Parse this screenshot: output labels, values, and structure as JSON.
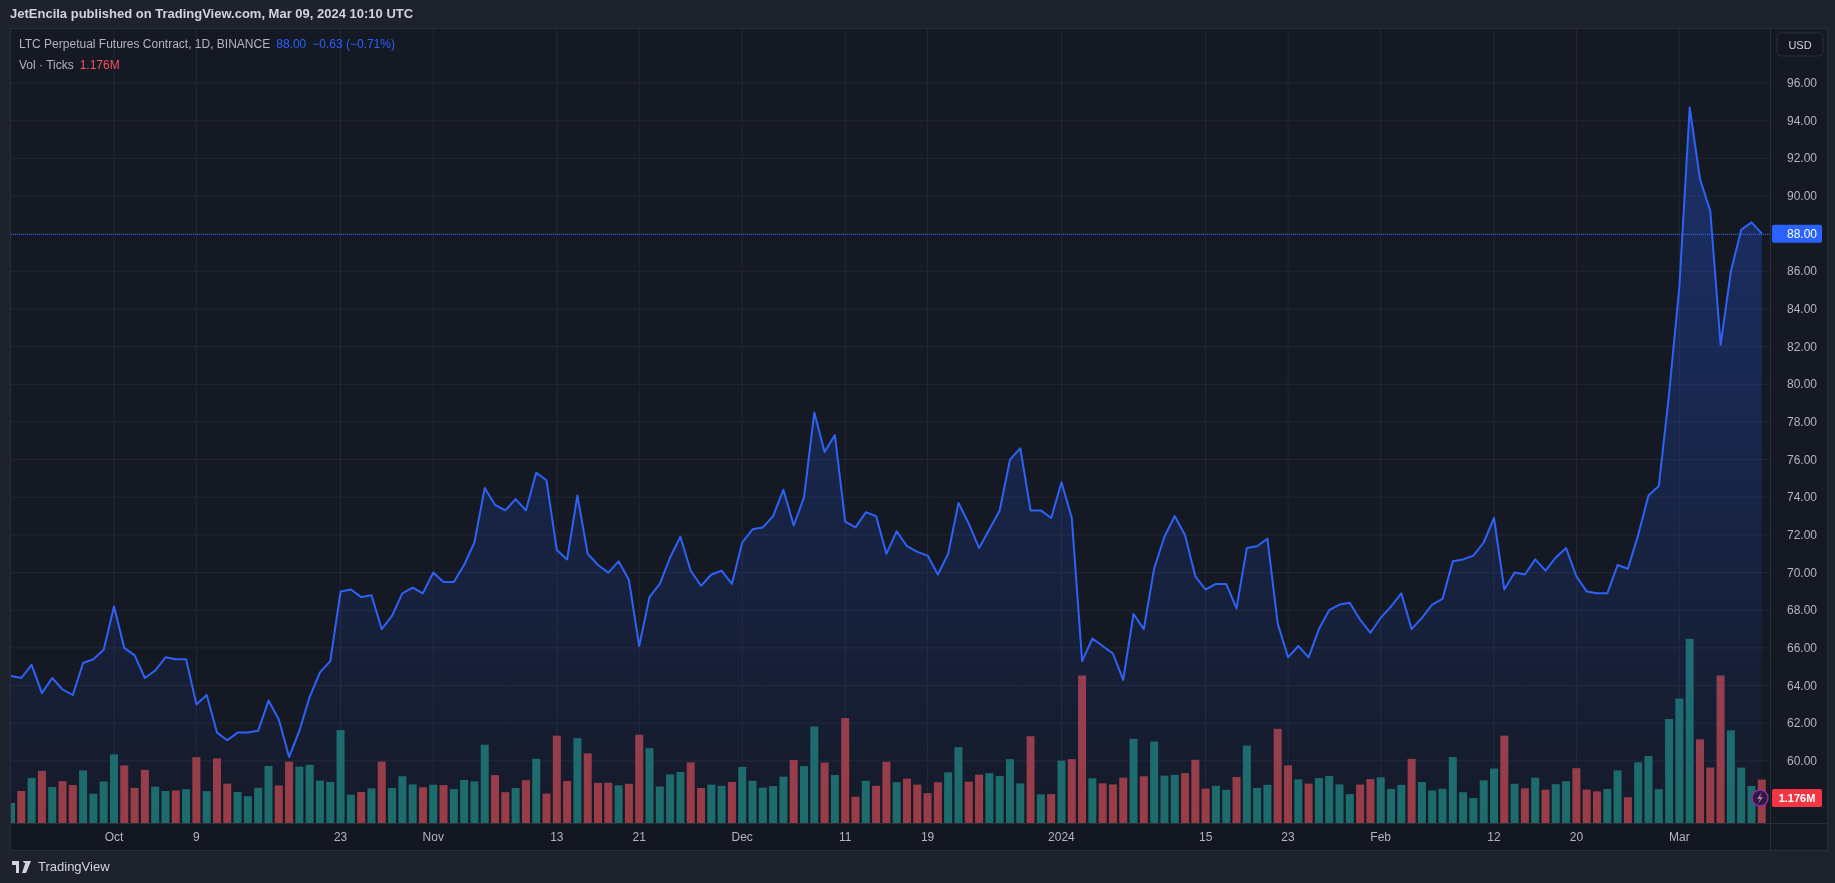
{
  "header": {
    "text": "JetEncila published on TradingView.com, Mar 09, 2024 10:10 UTC"
  },
  "legend": {
    "symbol": "LTC Perpetual Futures Contract, 1D, BINANCE",
    "price": "88.00",
    "change": "−0.63 (−0.71%)",
    "volume_label": "Vol · Ticks",
    "volume_value": "1.176M"
  },
  "price_axis": {
    "currency": "USD",
    "last_price_label": "88.00",
    "volume_badge": "1.176M"
  },
  "chart": {
    "chart_data": {
      "type": "area",
      "grid": true,
      "ylim": [
        56.7,
        98.87
      ],
      "categories": [
        null,
        null,
        null,
        null,
        null,
        null,
        null,
        null,
        null,
        null,
        "Oct",
        null,
        null,
        null,
        null,
        null,
        null,
        null,
        "9",
        null,
        null,
        null,
        null,
        null,
        null,
        null,
        null,
        null,
        null,
        null,
        null,
        null,
        "23",
        null,
        null,
        null,
        null,
        null,
        null,
        null,
        null,
        "Nov",
        null,
        null,
        null,
        null,
        null,
        null,
        null,
        null,
        null,
        null,
        null,
        "13",
        null,
        null,
        null,
        null,
        null,
        null,
        null,
        "21",
        null,
        null,
        null,
        null,
        null,
        null,
        null,
        null,
        null,
        "Dec",
        null,
        null,
        null,
        null,
        null,
        null,
        null,
        null,
        null,
        "11",
        null,
        null,
        null,
        null,
        null,
        null,
        null,
        "19",
        null,
        null,
        null,
        null,
        null,
        null,
        null,
        null,
        null,
        null,
        null,
        null,
        "2024",
        null,
        null,
        null,
        null,
        null,
        null,
        null,
        null,
        null,
        null,
        null,
        null,
        null,
        "15",
        null,
        null,
        null,
        null,
        null,
        null,
        null,
        "23",
        null,
        null,
        null,
        null,
        null,
        null,
        null,
        null,
        "Feb",
        null,
        null,
        null,
        null,
        null,
        null,
        null,
        null,
        null,
        null,
        "12",
        null,
        null,
        null,
        null,
        null,
        null,
        null,
        "20",
        null,
        null,
        null,
        null,
        null,
        null,
        null,
        null,
        null,
        "Mar",
        null,
        null,
        null,
        null,
        null,
        null,
        null,
        null
      ],
      "values": [
        64.5,
        64.4,
        65.1,
        63.6,
        64.4,
        63.8,
        63.5,
        65.2,
        65.4,
        65.9,
        68.2,
        66.0,
        65.6,
        64.4,
        64.8,
        65.5,
        65.4,
        65.4,
        63.0,
        63.5,
        61.5,
        61.1,
        61.5,
        61.5,
        61.6,
        63.2,
        62.2,
        60.2,
        61.6,
        63.4,
        64.7,
        65.3,
        69.0,
        69.1,
        68.7,
        68.8,
        67.0,
        67.7,
        68.9,
        69.2,
        68.9,
        70.0,
        69.5,
        69.5,
        70.4,
        71.6,
        74.5,
        73.6,
        73.3,
        73.9,
        73.3,
        75.3,
        74.9,
        71.2,
        70.7,
        74.1,
        71.0,
        70.4,
        70.0,
        70.6,
        69.6,
        66.1,
        68.7,
        69.4,
        70.8,
        71.9,
        70.1,
        69.3,
        69.9,
        70.1,
        69.4,
        71.6,
        72.3,
        72.4,
        73.0,
        74.4,
        72.5,
        74.0,
        78.5,
        76.4,
        77.3,
        72.7,
        72.4,
        73.2,
        73.0,
        71.0,
        72.2,
        71.4,
        71.1,
        70.9,
        69.9,
        71.0,
        73.7,
        72.6,
        71.3,
        72.3,
        73.3,
        76.0,
        76.6,
        73.3,
        73.3,
        72.9,
        74.8,
        72.9,
        65.3,
        66.5,
        66.1,
        65.7,
        64.3,
        67.8,
        67.0,
        70.2,
        71.9,
        73.0,
        72.0,
        69.8,
        69.1,
        69.4,
        69.4,
        68.1,
        71.3,
        71.4,
        71.8,
        67.3,
        65.5,
        66.1,
        65.5,
        67.0,
        68.0,
        68.3,
        68.4,
        67.5,
        66.8,
        67.6,
        68.2,
        68.9,
        67.0,
        67.6,
        68.3,
        68.6,
        70.6,
        70.7,
        70.9,
        71.6,
        72.9,
        69.1,
        70.0,
        69.9,
        70.7,
        70.1,
        70.8,
        71.3,
        69.8,
        69.0,
        68.9,
        68.9,
        70.4,
        70.2,
        72.0,
        74.1,
        74.6,
        79.5,
        85.2,
        94.7,
        90.9,
        89.2,
        82.1,
        86.0,
        88.2,
        88.6,
        88.0
      ],
      "yticks": [
        {
          "value": 60,
          "label": "60.00"
        },
        {
          "value": 62,
          "label": "62.00"
        },
        {
          "value": 64,
          "label": "64.00"
        },
        {
          "value": 66,
          "label": "66.00"
        },
        {
          "value": 68,
          "label": "68.00"
        },
        {
          "value": 70,
          "label": "70.00"
        },
        {
          "value": 72,
          "label": "72.00"
        },
        {
          "value": 74,
          "label": "74.00"
        },
        {
          "value": 76,
          "label": "76.00"
        },
        {
          "value": 78,
          "label": "78.00"
        },
        {
          "value": 80,
          "label": "80.00"
        },
        {
          "value": 82,
          "label": "82.00"
        },
        {
          "value": 84,
          "label": "84.00"
        },
        {
          "value": 86,
          "label": "86.00"
        },
        {
          "value": 90,
          "label": "90.00"
        },
        {
          "value": 92,
          "label": "92.00"
        },
        {
          "value": 94,
          "label": "94.00"
        },
        {
          "value": 96,
          "label": "96.00"
        }
      ]
    }
  },
  "footer": {
    "brand": "TradingView"
  }
}
